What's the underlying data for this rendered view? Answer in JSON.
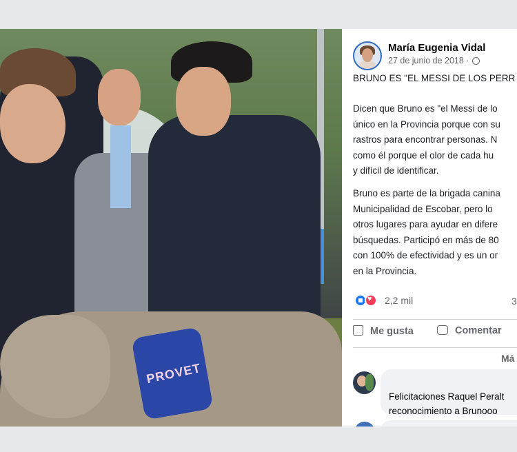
{
  "post": {
    "author": "María Eugenia Vidal",
    "date": "27 de junio de 2018 ·",
    "title": "BRUNO ES \"EL MESSI DE LOS PERR",
    "paragraph1": [
      "Dicen que Bruno es \"el Messi de lo",
      "único en la Provincia porque con su",
      "rastros para encontrar personas. N",
      "como él porque el olor de cada hu",
      "y difícil de identificar."
    ],
    "paragraph2": [
      "Bruno es parte de la brigada canina",
      "Municipalidad de Escobar, pero lo",
      "otros lugares para ayudar en difere",
      "búsquedas. Participó en más de 80",
      "con 100% de efectividad y es un or",
      "en la Provincia."
    ],
    "photo": {
      "harness_text": "PROVET"
    }
  },
  "reactions": {
    "count": "2,2 mil",
    "right_partial": "3"
  },
  "actions": {
    "like": "Me gusta",
    "comment": "Comentar",
    "more": "Má"
  },
  "comment": {
    "lines": [
      "Felicitaciones Raquel Peralt",
      "reconocimiento a Brunooo"
    ]
  },
  "colors": {
    "like_blue": "#1877f2",
    "love_red": "#f33e58",
    "secondary_text": "#65676b",
    "harness_blue": "#2a47a8"
  }
}
